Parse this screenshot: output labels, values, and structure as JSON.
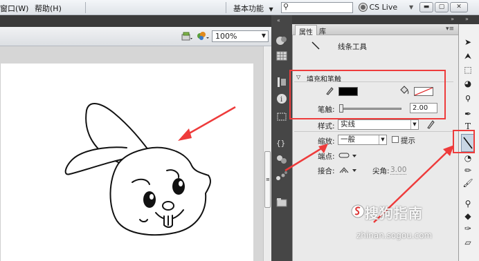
{
  "menubar": {
    "items": [
      "窗口(W)",
      "帮助(H)"
    ],
    "workspace": "基本功能",
    "search_value": "",
    "cs_live": "CS Live"
  },
  "edit_bar": {
    "zoom": "100%"
  },
  "properties_panel": {
    "tabs": [
      "属性",
      "库"
    ],
    "tool_name": "线条工具",
    "fill_stroke_section": "填充和笔触",
    "stroke_color": "#000000",
    "fill_color": "none",
    "stroke_label": "笔触:",
    "stroke_value": "2.00",
    "style_label": "样式:",
    "style_value": "实线",
    "scale_label": "缩放:",
    "scale_value": "一般",
    "hint_label": "提示",
    "cap_label": "端点:",
    "join_label": "接合:",
    "miter_label": "尖角:",
    "miter_value": "3.00"
  },
  "watermark": {
    "text": "搜狗指南",
    "url": "zhinan.sogou.com"
  },
  "colors": {
    "annotation_red": "#ee3b3b",
    "dark_chrome": "#3c3c3c"
  }
}
